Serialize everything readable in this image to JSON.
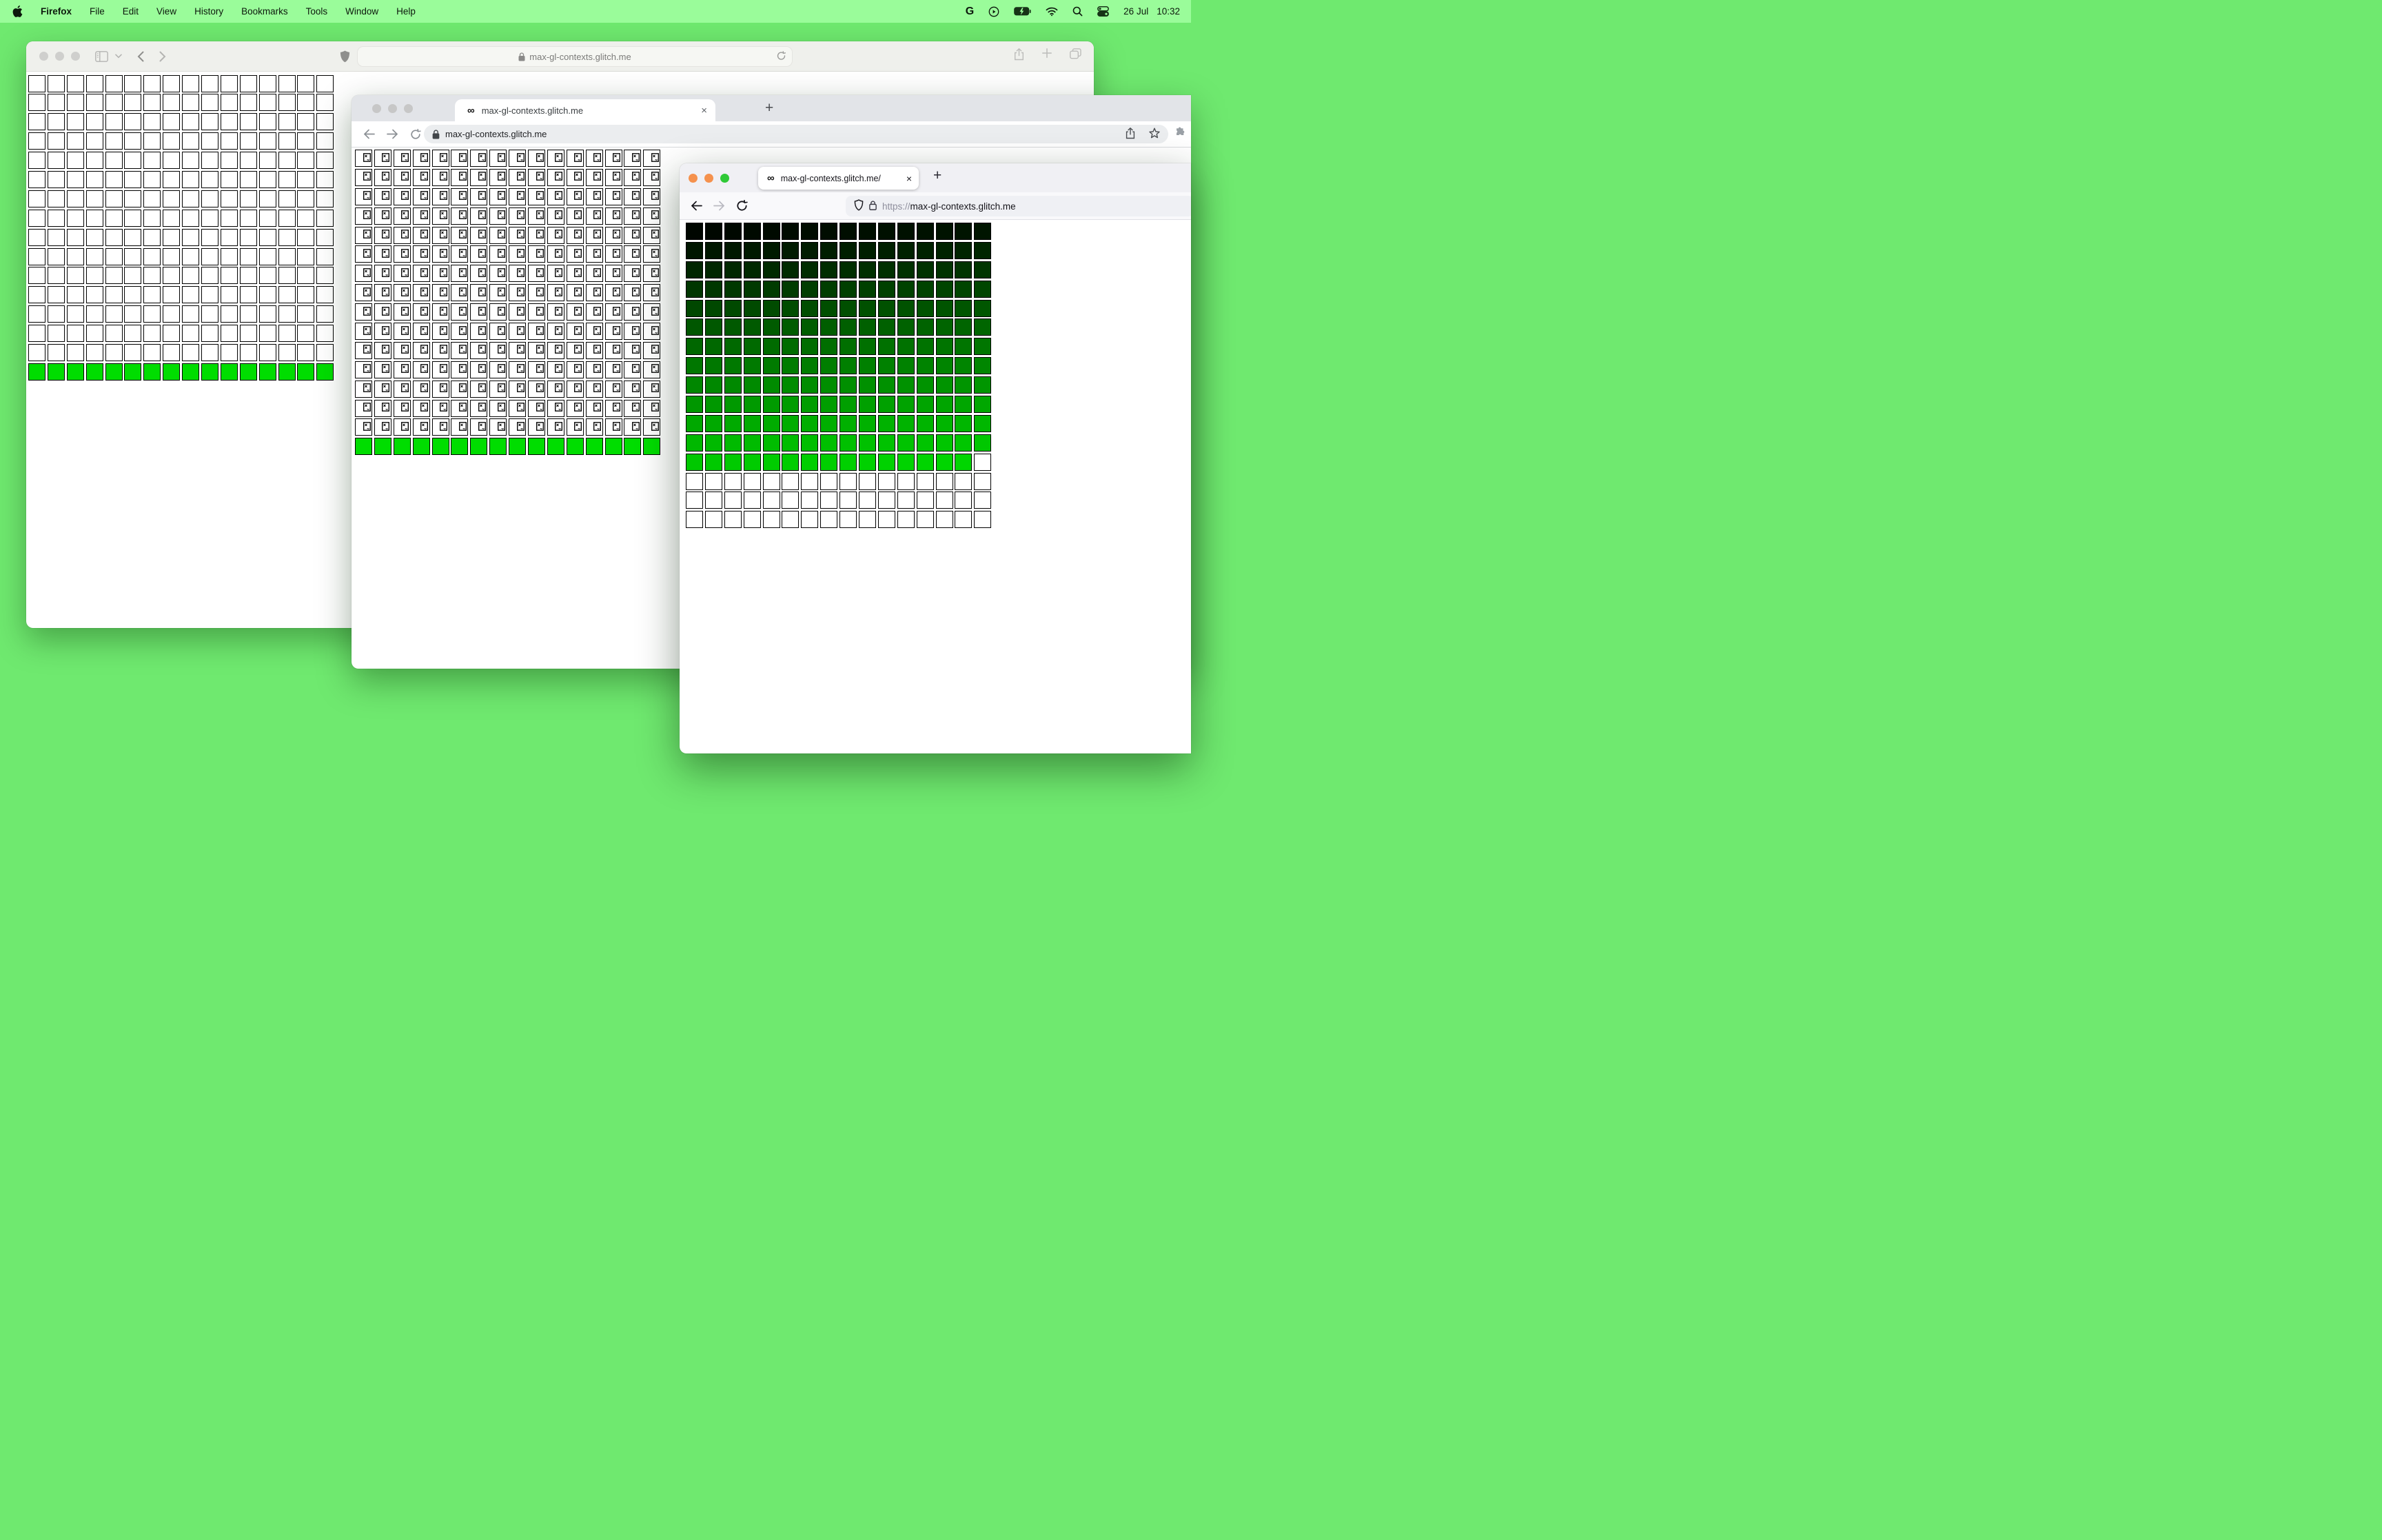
{
  "menu_bar": {
    "app": "Firefox",
    "items": [
      "File",
      "Edit",
      "View",
      "History",
      "Bookmarks",
      "Tools",
      "Window",
      "Help"
    ],
    "status": {
      "date": "26 Jul",
      "time": "10:32"
    },
    "status_icons": [
      "google-icon",
      "play-icon",
      "battery-charging-icon",
      "wifi-icon",
      "search-icon",
      "control-center-icon"
    ]
  },
  "safari_window": {
    "url": "max-gl-contexts.glitch.me",
    "toolbar_icons": [
      "sidebar-icon",
      "chevron-down-icon",
      "back-icon",
      "forward-icon",
      "shield-icon",
      "lock-icon",
      "reload-icon",
      "share-icon",
      "new-tab-icon",
      "tabs-overview-icon"
    ]
  },
  "chrome_window": {
    "tab_title": "max-gl-contexts.glitch.me",
    "tab_favicon": "infinity-icon",
    "url": "max-gl-contexts.glitch.me",
    "toolbar_icons": [
      "back-icon",
      "forward-icon",
      "reload-icon",
      "lock-icon",
      "share-icon",
      "star-icon",
      "extensions-puzzle-icon"
    ],
    "close_tab_label": "×",
    "new_tab_label": "+"
  },
  "firefox_window": {
    "tab_title": "max-gl-contexts.glitch.me/",
    "tab_favicon": "infinity-icon",
    "url_scheme": "https://",
    "url_domain": "max-gl-contexts.glitch.me",
    "toolbar_icons": [
      "back-icon",
      "forward-icon",
      "reload-icon",
      "tracking-shield-icon",
      "lock-icon"
    ],
    "close_tab_label": "×",
    "new_tab_label": "+"
  },
  "grids": {
    "safari": {
      "kind": "plain",
      "cols": 16,
      "rows": 16,
      "plain_rows": 15,
      "green_rows": 1
    },
    "chrome": {
      "kind": "broken",
      "cols": 16,
      "rows": 16,
      "broken_rows": 15,
      "green_rows": 1
    },
    "firefox": {
      "kind": "gradient",
      "cols": 16,
      "rows": 16,
      "colored_cells": 207,
      "green_channel_start": 6,
      "green_channel_end": 214
    }
  },
  "colors": {
    "desktop": "#6fe96f",
    "menubar": "#9afc9a",
    "green_cell": "#00dd00",
    "firefox_traffic_lights": [
      "#f5914d",
      "#f5914d",
      "#2fc937"
    ],
    "inactive_traffic_light": "#cdcdcb",
    "cell_border": "#000000"
  }
}
